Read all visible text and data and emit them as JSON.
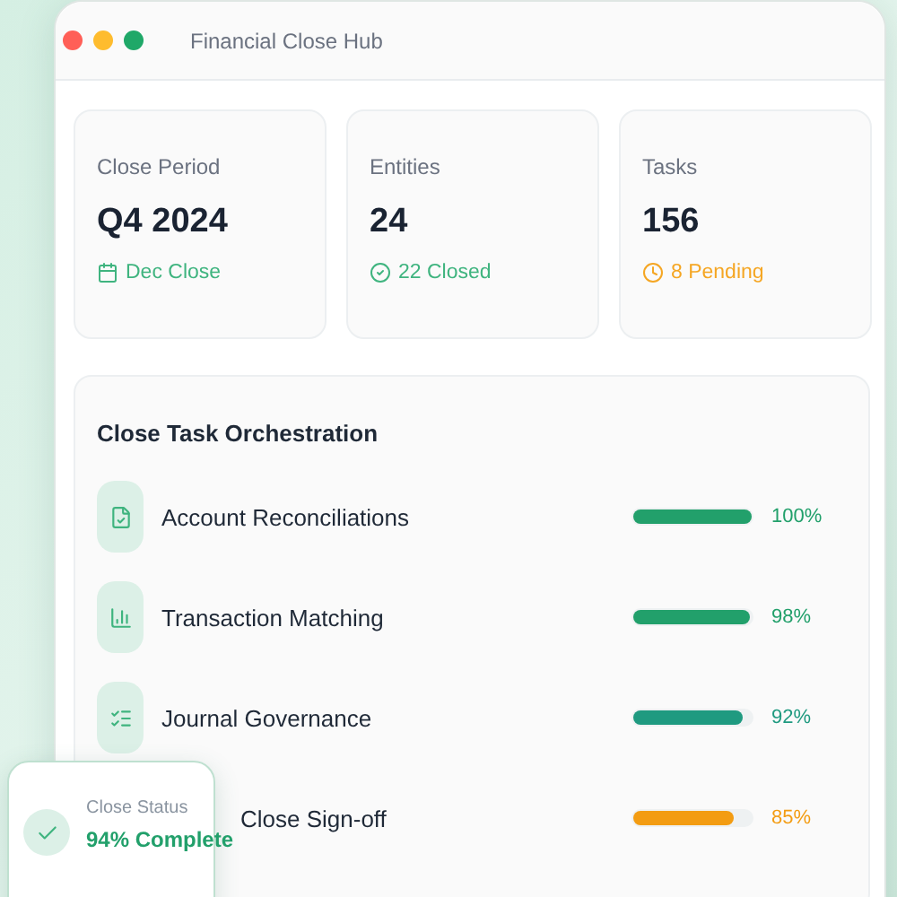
{
  "window": {
    "title": "Financial Close Hub"
  },
  "stats": [
    {
      "label": "Close Period",
      "value": "Q4 2024",
      "meta": "Dec Close",
      "color": "#3fb47f"
    },
    {
      "label": "Entities",
      "value": "24",
      "meta": "22 Closed",
      "color": "#3fb47f"
    },
    {
      "label": "Tasks",
      "value": "156",
      "meta": "8 Pending",
      "color": "#f5a623"
    }
  ],
  "tasks": {
    "title": "Close Task Orchestration",
    "rows": [
      {
        "label": "Account Reconciliations",
        "level": 1.0,
        "reading": "100%",
        "color": "#22a06b"
      },
      {
        "label": "Transaction Matching",
        "level": 0.98,
        "reading": "98%",
        "color": "#22a06b"
      },
      {
        "label": "Journal Governance",
        "level": 0.92,
        "reading": "92%",
        "color": "#1f9a80"
      },
      {
        "label": "Close Sign-off",
        "level": 0.85,
        "reading": "85%",
        "color": "#f39c12"
      }
    ]
  },
  "toast": {
    "label": "Close Status",
    "value": "94% Complete"
  }
}
